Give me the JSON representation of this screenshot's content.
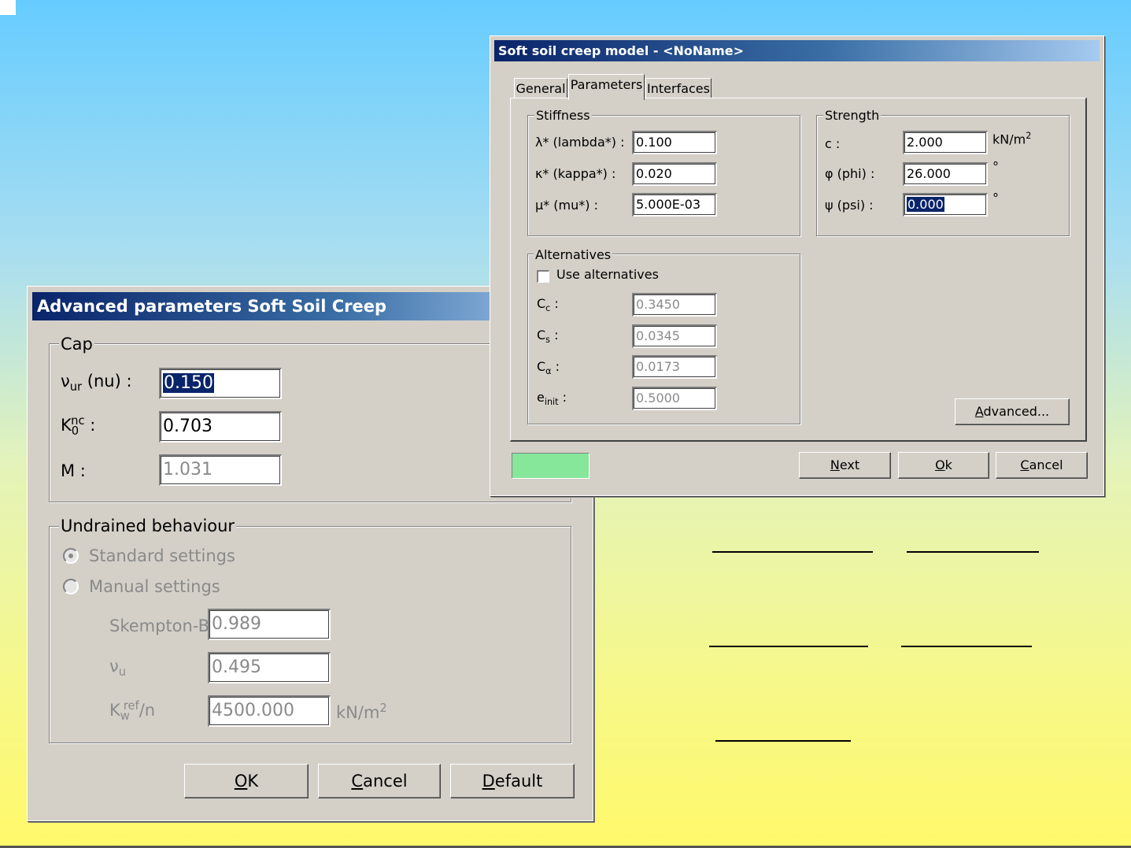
{
  "advanced_dialog": {
    "title": "Advanced parameters Soft Soil Creep",
    "cap_group": {
      "legend": "Cap",
      "nu_ur_label": "ν",
      "nu_ur_sub": "ur",
      "nu_ur_suffix": " (nu) :",
      "nu_ur_value": "0.150",
      "k0_label": "K",
      "k0_sub": "0",
      "k0_sup": "nc",
      "k0_suffix": " :",
      "k0_value": "0.703",
      "m_label": "M :",
      "m_value": "1.031"
    },
    "undrained_group": {
      "legend": "Undrained behaviour",
      "standard_settings": "Standard settings",
      "manual_settings": "Manual settings",
      "skempton_label": "Skempton-B",
      "skempton_value": "0.989",
      "nu_u_label": "ν",
      "nu_u_sub": "u",
      "nu_u_value": "0.495",
      "kw_label": "K",
      "kw_sub": "w",
      "kw_sup": "ref",
      "kw_suffix": "/n",
      "kw_value": "4500.000",
      "kw_unit": "kN/m",
      "kw_unit_sup": "2"
    },
    "buttons": {
      "ok": "OK",
      "cancel": "Cancel",
      "default": "Default"
    }
  },
  "ssc_dialog": {
    "title": "Soft soil creep model - <NoName>",
    "tabs": [
      "General",
      "Parameters",
      "Interfaces"
    ],
    "stiffness": {
      "legend": "Stiffness",
      "lambda_label": "λ* (lambda*) :",
      "lambda_value": "0.100",
      "kappa_label": "κ* (kappa*) :",
      "kappa_value": "0.020",
      "mu_label": "μ* (mu*) :",
      "mu_value": "5.000E-03"
    },
    "strength": {
      "legend": "Strength",
      "c_label": "c :",
      "c_value": "2.000",
      "c_unit": "kN/m",
      "c_unit_sup": "2",
      "phi_label": "φ (phi) :",
      "phi_value": "26.000",
      "phi_unit": "°",
      "psi_label": "ψ (psi) :",
      "psi_value": "0.000",
      "psi_unit": "°"
    },
    "alternatives": {
      "legend": "Alternatives",
      "use_alternatives": "Use alternatives",
      "cc_label": "C",
      "cc_sub": "c",
      "cc_value": "0.3450",
      "cs_label": "C",
      "cs_sub": "s",
      "cs_value": "0.0345",
      "ca_label": "C",
      "ca_sub": "α",
      "ca_value": "0.0173",
      "einit_label": "e",
      "einit_sub": "init",
      "einit_value": "0.5000",
      "colon": ":"
    },
    "buttons": {
      "advanced": "Advanced...",
      "next": "Next",
      "ok": "Ok",
      "cancel": "Cancel"
    },
    "status_color": "#86e69a"
  }
}
